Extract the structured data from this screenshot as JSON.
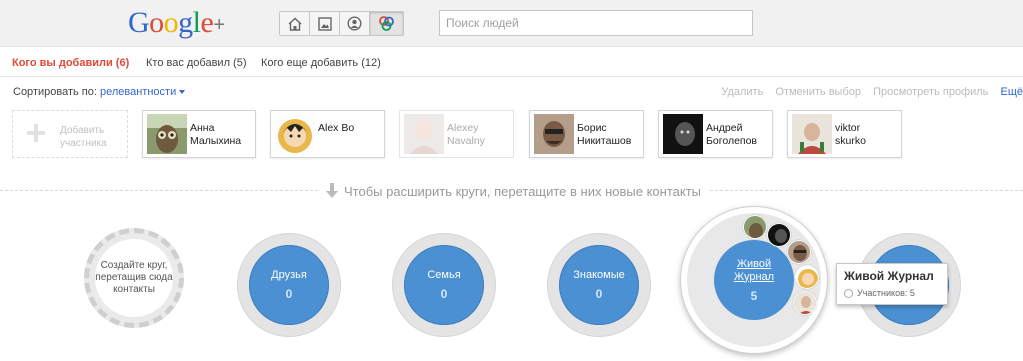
{
  "logo": {
    "text_g": "G",
    "text_o1": "o",
    "text_o2": "o",
    "text_g2": "g",
    "text_l": "l",
    "text_e": "e",
    "plus": "+"
  },
  "nav": {
    "icons": [
      "home-icon",
      "photos-icon",
      "profile-icon",
      "circles-icon"
    ],
    "active": "circles-icon"
  },
  "search": {
    "placeholder": "Поиск людей"
  },
  "tabs": [
    {
      "label": "Кого вы добавили (6)",
      "active": true
    },
    {
      "label": "Кто вас добавил (5)",
      "active": false
    },
    {
      "label": "Кого еще добавить (12)",
      "active": false
    }
  ],
  "sort": {
    "label": "Сортировать по:",
    "value": "релевантности"
  },
  "actions": {
    "delete": "Удалить",
    "deselect": "Отменить выбор",
    "view_profile": "Просмотреть профиль",
    "more": "Ещё"
  },
  "add_card": {
    "label": "Добавить участника"
  },
  "contacts": [
    {
      "line1": "Анна",
      "line2": "Малыхина"
    },
    {
      "line1": "Alex Bo",
      "line2": ""
    },
    {
      "line1": "Alexey",
      "line2": "Navalny"
    },
    {
      "line1": "Борис",
      "line2": "Никиташов"
    },
    {
      "line1": "Андрей",
      "line2": "Боголепов"
    },
    {
      "line1": "viktor",
      "line2": "skurko"
    }
  ],
  "hint": "Чтобы расширить круги, перетащите в них новые контакты",
  "create_circle": {
    "label": "Создайте круг, перетащив сюда контакты"
  },
  "circles": [
    {
      "name": "Друзья",
      "count": "0"
    },
    {
      "name": "Семья",
      "count": "0"
    },
    {
      "name": "Знакомые",
      "count": "0"
    },
    {
      "name_line1": "Живой",
      "name_line2": "Журнал",
      "count": "5"
    }
  ],
  "tooltip": {
    "title": "Живой Журнал",
    "members": "Участников: 5"
  },
  "colors": {
    "accent_red": "#dd4b39",
    "link_blue": "#3366cc",
    "circle_blue": "#4a90d2"
  }
}
